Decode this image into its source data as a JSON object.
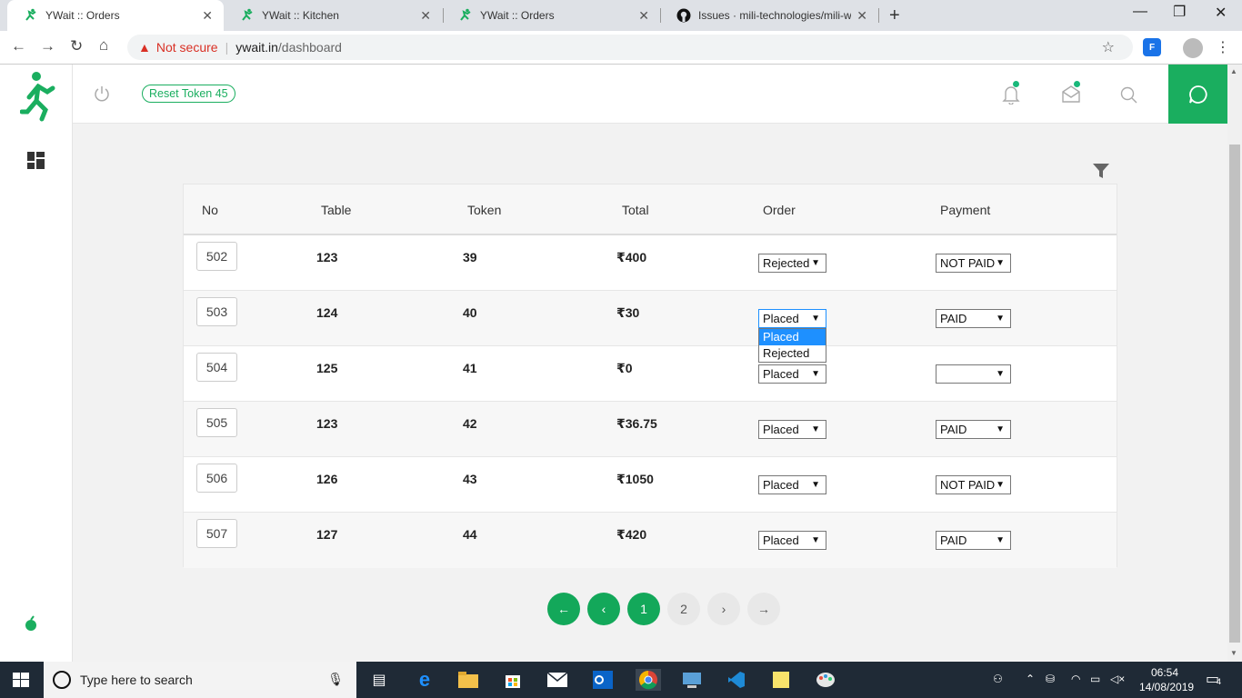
{
  "browser": {
    "tabs": [
      {
        "title": "YWait :: Orders",
        "active": true
      },
      {
        "title": "YWait :: Kitchen",
        "active": false
      },
      {
        "title": "YWait :: Orders",
        "active": false
      },
      {
        "title": "Issues · mili-technologies/mili-we",
        "active": false
      }
    ],
    "not_secure": "Not secure",
    "host": "ywait.in",
    "path": "/dashboard",
    "ext_label": "F"
  },
  "header": {
    "reset_token": "Reset Token 45"
  },
  "table": {
    "columns": [
      "No",
      "Table",
      "Token",
      "Total",
      "Order",
      "Payment"
    ],
    "rows": [
      {
        "no": "502",
        "table": "123",
        "token": "39",
        "total": "₹400",
        "order": "Rejected",
        "payment": "NOT PAID"
      },
      {
        "no": "503",
        "table": "124",
        "token": "40",
        "total": "₹30",
        "order": "Placed",
        "payment": "PAID"
      },
      {
        "no": "504",
        "table": "125",
        "token": "41",
        "total": "₹0",
        "order": "Placed",
        "payment": ""
      },
      {
        "no": "505",
        "table": "123",
        "token": "42",
        "total": "₹36.75",
        "order": "Placed",
        "payment": "PAID"
      },
      {
        "no": "506",
        "table": "126",
        "token": "43",
        "total": "₹1050",
        "order": "Placed",
        "payment": "NOT PAID"
      },
      {
        "no": "507",
        "table": "127",
        "token": "44",
        "total": "₹420",
        "order": "Placed",
        "payment": "PAID"
      }
    ],
    "open_dropdown_options": [
      "Placed",
      "Rejected"
    ]
  },
  "pagination": {
    "pages": [
      "1",
      "2"
    ]
  },
  "taskbar": {
    "search_placeholder": "Type here to search",
    "time": "06:54",
    "date": "14/08/2019",
    "notifications": "4"
  },
  "colors": {
    "brand": "#1aae5f",
    "highlight": "#1e90ff"
  }
}
